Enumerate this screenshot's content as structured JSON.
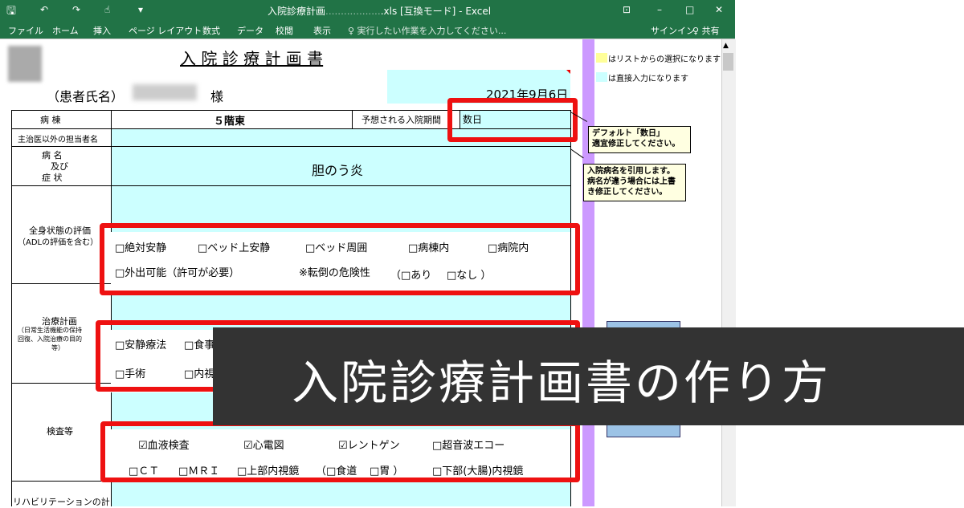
{
  "window": {
    "title": "入院診療計画",
    "title_mid": "..................",
    "title_tail": ".xls  [互換モード] - Excel",
    "controls": {
      "ribbon_display": "⊡",
      "minimize": "–",
      "maximize": "□",
      "close": "✕"
    }
  },
  "ribbon": {
    "tabs": [
      "ファイル",
      "ホーム",
      "挿入",
      "ページ レイアウト",
      "数式",
      "データ",
      "校閲",
      "表示"
    ],
    "tellme": "♀ 実行したい作業を入力してください...",
    "signin": "サインイン",
    "share": "♀ 共有"
  },
  "sheet": {
    "doc_title": "入 院 診 療 計 画 書",
    "patient_label": "（患者氏名）",
    "patient_suffix": "様",
    "date": "2021年9月6日",
    "ward_label": "病 棟",
    "ward_value": "５階東",
    "period_label": "予想される入院期間",
    "period_value": "数日",
    "staff_label": "主治医以外の担当者名",
    "disease_label_1": "病 名",
    "disease_label_2": "及び",
    "disease_label_3": "症 状",
    "disease_value": "胆のう炎",
    "general_label_1": "全身状態の評価",
    "general_label_2": "（ADLの評価を含む）",
    "general_row1": [
      "□絶対安静",
      "□ベッド上安静",
      "□ベッド周囲",
      "□病棟内",
      "□病院内"
    ],
    "general_row2": [
      "□外出可能（許可が必要）",
      "※転倒の危険性",
      "（□あり",
      "□なし ）"
    ],
    "treatment_label_1": "治療計画",
    "treatment_label_2": "（日常生活機能の保持",
    "treatment_label_3": "回復、入院治療の目的",
    "treatment_label_4": "等）",
    "treatment_row1": [
      "□安静療法",
      "□食事"
    ],
    "treatment_row2": [
      "□手術",
      "□内視"
    ],
    "exam_label": "検査等",
    "exam_row1": [
      "☑血液検査",
      "☑心電図",
      "☑レントゲン",
      "□超音波エコー"
    ],
    "exam_row2": [
      "□ＣＴ",
      "□ＭＲＩ",
      "□上部内視鏡",
      "（□食道",
      "□胃 ）",
      "□下部(大腸)内視鏡"
    ],
    "rehab_label": "リハビリテーションの計",
    "legend_yellow": "はリストからの選択になります",
    "legend_cyan": "は直接入力になります",
    "note1": "デフォルト「数日」\n適宜修正してください。",
    "note2": "入院病名を引用します。\n病名が違う場合には上書\nき修正してください。"
  },
  "banner": {
    "text": "入院診療計画書の作り方"
  },
  "colors": {
    "excel_green": "#217346",
    "input_cyan": "#ccffff",
    "list_yellow": "#ffff99",
    "highlight_red": "#ee1111",
    "purple_bar": "#cc99ff",
    "banner_bg": "#333333"
  }
}
